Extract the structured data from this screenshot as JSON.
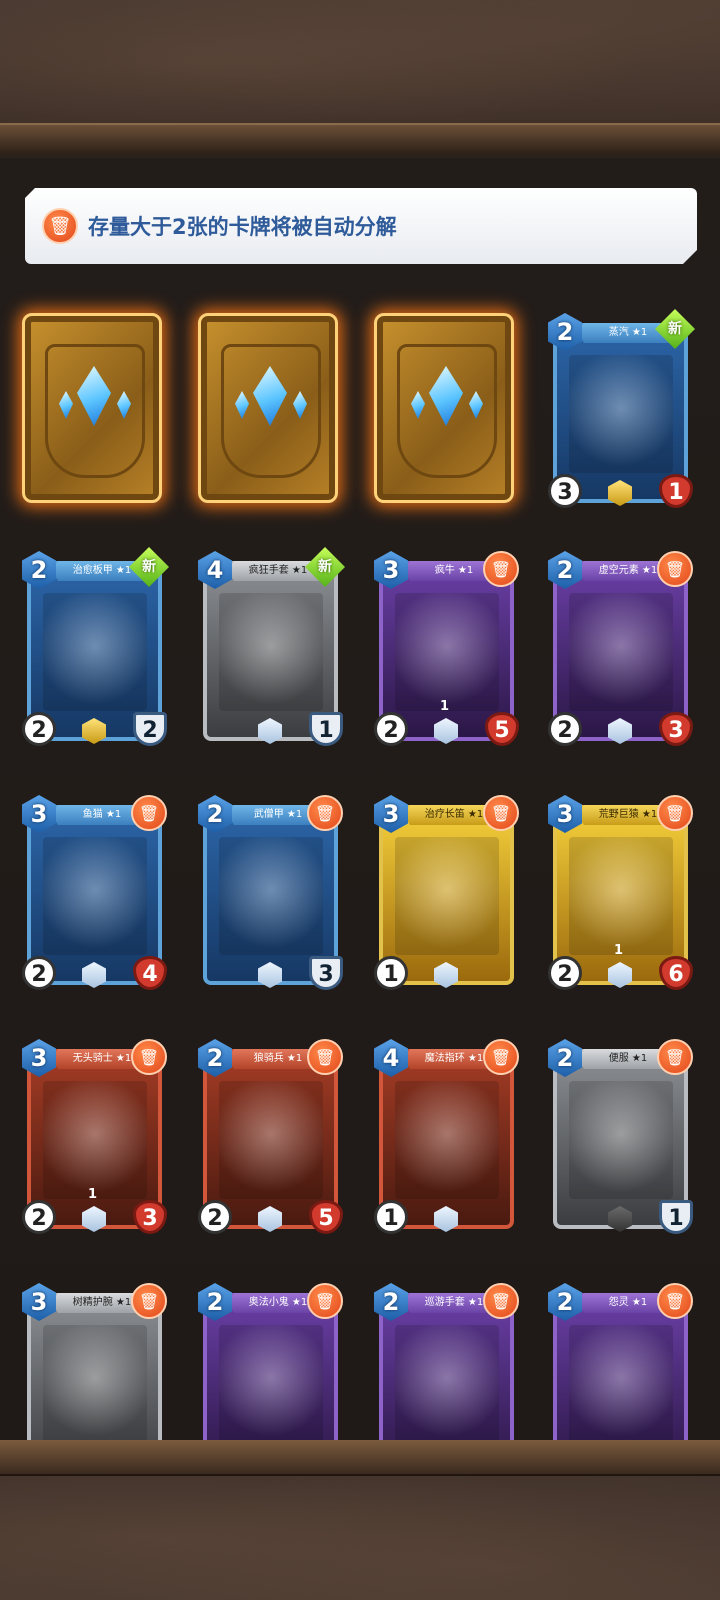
{
  "notice": {
    "text": "存量大于2张的卡牌将被自动分解",
    "icon": "trash-icon"
  },
  "colors": {
    "accent_orange": "#e2471a",
    "glow": "#ff7814",
    "text_blue": "#2f5b9a"
  },
  "card_backs": [
    {
      "crystal": "blue"
    },
    {
      "crystal": "blue"
    },
    {
      "crystal": "blue"
    }
  ],
  "cards": [
    {
      "name": "蒸汽 ★1",
      "cost": "2",
      "atk": "3",
      "hp": "1",
      "theme": "blue",
      "badge": "新",
      "rarity": "gold"
    },
    {
      "name": "治愈板甲 ★1",
      "cost": "2",
      "atk": "2",
      "hp": "2",
      "theme": "blue",
      "badge": "新",
      "rarity": "gold",
      "hp_style": "def"
    },
    {
      "name": "疯狂手套 ★1",
      "cost": "4",
      "atk": "",
      "hp": "1",
      "theme": "gray",
      "badge": "新",
      "rarity": "silver",
      "hp_style": "def"
    },
    {
      "name": "疯牛 ★1",
      "cost": "3",
      "atk": "2",
      "hp": "5",
      "theme": "purple",
      "badge": "",
      "rarity": "silver",
      "sub": "1"
    },
    {
      "name": "虚空元素 ★1",
      "cost": "2",
      "atk": "2",
      "hp": "3",
      "theme": "purple",
      "badge": "",
      "rarity": "silver"
    },
    {
      "name": "鱼猫 ★1",
      "cost": "3",
      "atk": "2",
      "hp": "4",
      "theme": "blue",
      "badge": "",
      "rarity": "silver"
    },
    {
      "name": "武僧甲 ★1",
      "cost": "2",
      "atk": "",
      "hp": "3",
      "theme": "blue",
      "badge": "",
      "rarity": "silver",
      "hp_style": "def"
    },
    {
      "name": "治疗长笛 ★1",
      "cost": "3",
      "atk": "1",
      "hp": "",
      "theme": "gold",
      "badge": "",
      "rarity": "silver"
    },
    {
      "name": "荒野巨猿 ★1",
      "cost": "3",
      "atk": "2",
      "hp": "6",
      "theme": "gold",
      "badge": "",
      "rarity": "silver",
      "sub": "1"
    },
    {
      "name": "无头骑士 ★1",
      "cost": "3",
      "atk": "2",
      "hp": "3",
      "theme": "red",
      "badge": "",
      "rarity": "silver",
      "sub": "1"
    },
    {
      "name": "狼骑兵 ★1",
      "cost": "2",
      "atk": "2",
      "hp": "5",
      "theme": "red",
      "badge": "",
      "rarity": "silver"
    },
    {
      "name": "魔法指环 ★1",
      "cost": "4",
      "atk": "1",
      "hp": "",
      "theme": "red",
      "badge": "",
      "rarity": "silver"
    },
    {
      "name": "便服 ★1",
      "cost": "2",
      "atk": "",
      "hp": "1",
      "theme": "gray",
      "badge": "",
      "rarity": "dark",
      "hp_style": "def"
    },
    {
      "name": "树精护腕 ★1",
      "cost": "3",
      "atk": "",
      "hp": "",
      "theme": "gray",
      "badge": "",
      "rarity": "silver"
    },
    {
      "name": "奥法小鬼 ★1",
      "cost": "2",
      "atk": "",
      "hp": "",
      "theme": "purple",
      "badge": "",
      "rarity": "silver"
    },
    {
      "name": "巡游手套 ★1",
      "cost": "2",
      "atk": "",
      "hp": "",
      "theme": "purple",
      "badge": "",
      "rarity": "silver"
    },
    {
      "name": "怨灵 ★1",
      "cost": "2",
      "atk": "",
      "hp": "",
      "theme": "purple",
      "badge": "",
      "rarity": "silver"
    }
  ]
}
